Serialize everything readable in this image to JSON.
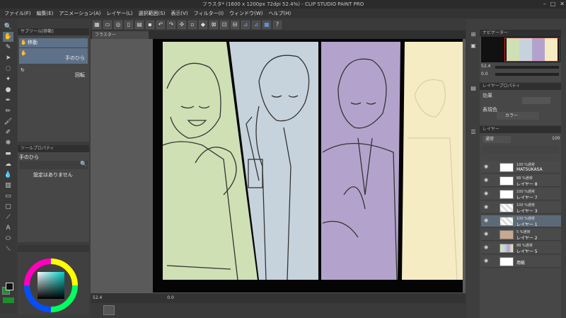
{
  "window": {
    "title": "フラスタ* (1600 x 1200px 72dpi 52.4%) - CLIP STUDIO PAINT PRO",
    "min": "–",
    "max": "□",
    "close": "✕"
  },
  "menu": [
    "ファイル(F)",
    "編集(E)",
    "アニメーション(A)",
    "レイヤー(L)",
    "選択範囲(S)",
    "表示(V)",
    "フィルター(I)",
    "ウィンドウ(W)",
    "ヘルプ(H)"
  ],
  "subtool": {
    "header": "サブツール[移動]",
    "group": "移動",
    "item1": "手のひら",
    "item2": "回転"
  },
  "toolprop": {
    "header": "ツールプロパティ",
    "name": "手のひら",
    "message": "設定はありません"
  },
  "canvas": {
    "tab": "フラスター",
    "zoom": "52.4",
    "angle": "0.0"
  },
  "colors": {
    "bg_sample": "#1f8f2e",
    "fg_sample": "#ffffff"
  },
  "right": {
    "navigator_header": "ナビゲーター",
    "nav_zoom": "52.4",
    "nav_angle": "0.0",
    "layerprop_header": "レイヤープロパティ",
    "effect_label": "効果",
    "express_label": "表現色",
    "express_value": "カラー",
    "layer_header": "レイヤー",
    "blend_mode": "通常",
    "opacity": "100"
  },
  "layers": [
    {
      "mode": "100 %通常",
      "name": "MATSUKASA",
      "type": "text"
    },
    {
      "mode": "88 %通常",
      "name": "レイヤー 8",
      "type": "blank"
    },
    {
      "mode": "100 %通常",
      "name": "レイヤー 7",
      "type": "blank"
    },
    {
      "mode": "100 %通常",
      "name": "レイヤー 3",
      "type": "checker"
    },
    {
      "mode": "100 %通常",
      "name": "レイヤー 1",
      "type": "checker",
      "selected": true
    },
    {
      "mode": "5 %通常",
      "name": "レイヤー 2",
      "type": "art"
    },
    {
      "mode": "88 %通常",
      "name": "レイヤー 5",
      "type": "color"
    },
    {
      "mode": "",
      "name": "用紙",
      "type": "paper"
    }
  ]
}
